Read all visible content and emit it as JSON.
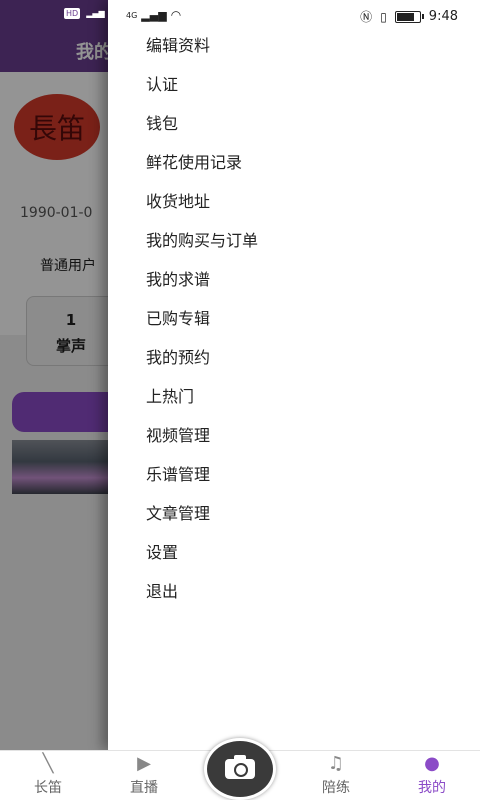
{
  "background": {
    "header_title": "我的",
    "avatar_text": "長笛",
    "birthdate": "1990-01-0",
    "user_type": "普通用户",
    "stat": {
      "value": "1",
      "label": "掌声"
    }
  },
  "status_bar": {
    "left_hd": "HD",
    "left_4g": "4G",
    "time": "9:48",
    "battery_percent": 80
  },
  "drawer_menu": [
    "编辑资料",
    "认证",
    "钱包",
    "鲜花使用记录",
    "收货地址",
    "我的购买与订单",
    "我的求谱",
    "已购专辑",
    "我的预约",
    "上热门",
    "视频管理",
    "乐谱管理",
    "文章管理",
    "设置",
    "退出"
  ],
  "tabbar": {
    "tabs": [
      {
        "label": "长笛",
        "icon": "flute-icon"
      },
      {
        "label": "直播",
        "icon": "video-camera-icon"
      },
      {
        "label": "陪练",
        "icon": "music-sheet-icon"
      },
      {
        "label": "我的",
        "icon": "user-icon",
        "active": true
      }
    ],
    "center": "camera-icon"
  },
  "colors": {
    "accent": "#8b4bc7",
    "header": "#6a3d8f"
  }
}
